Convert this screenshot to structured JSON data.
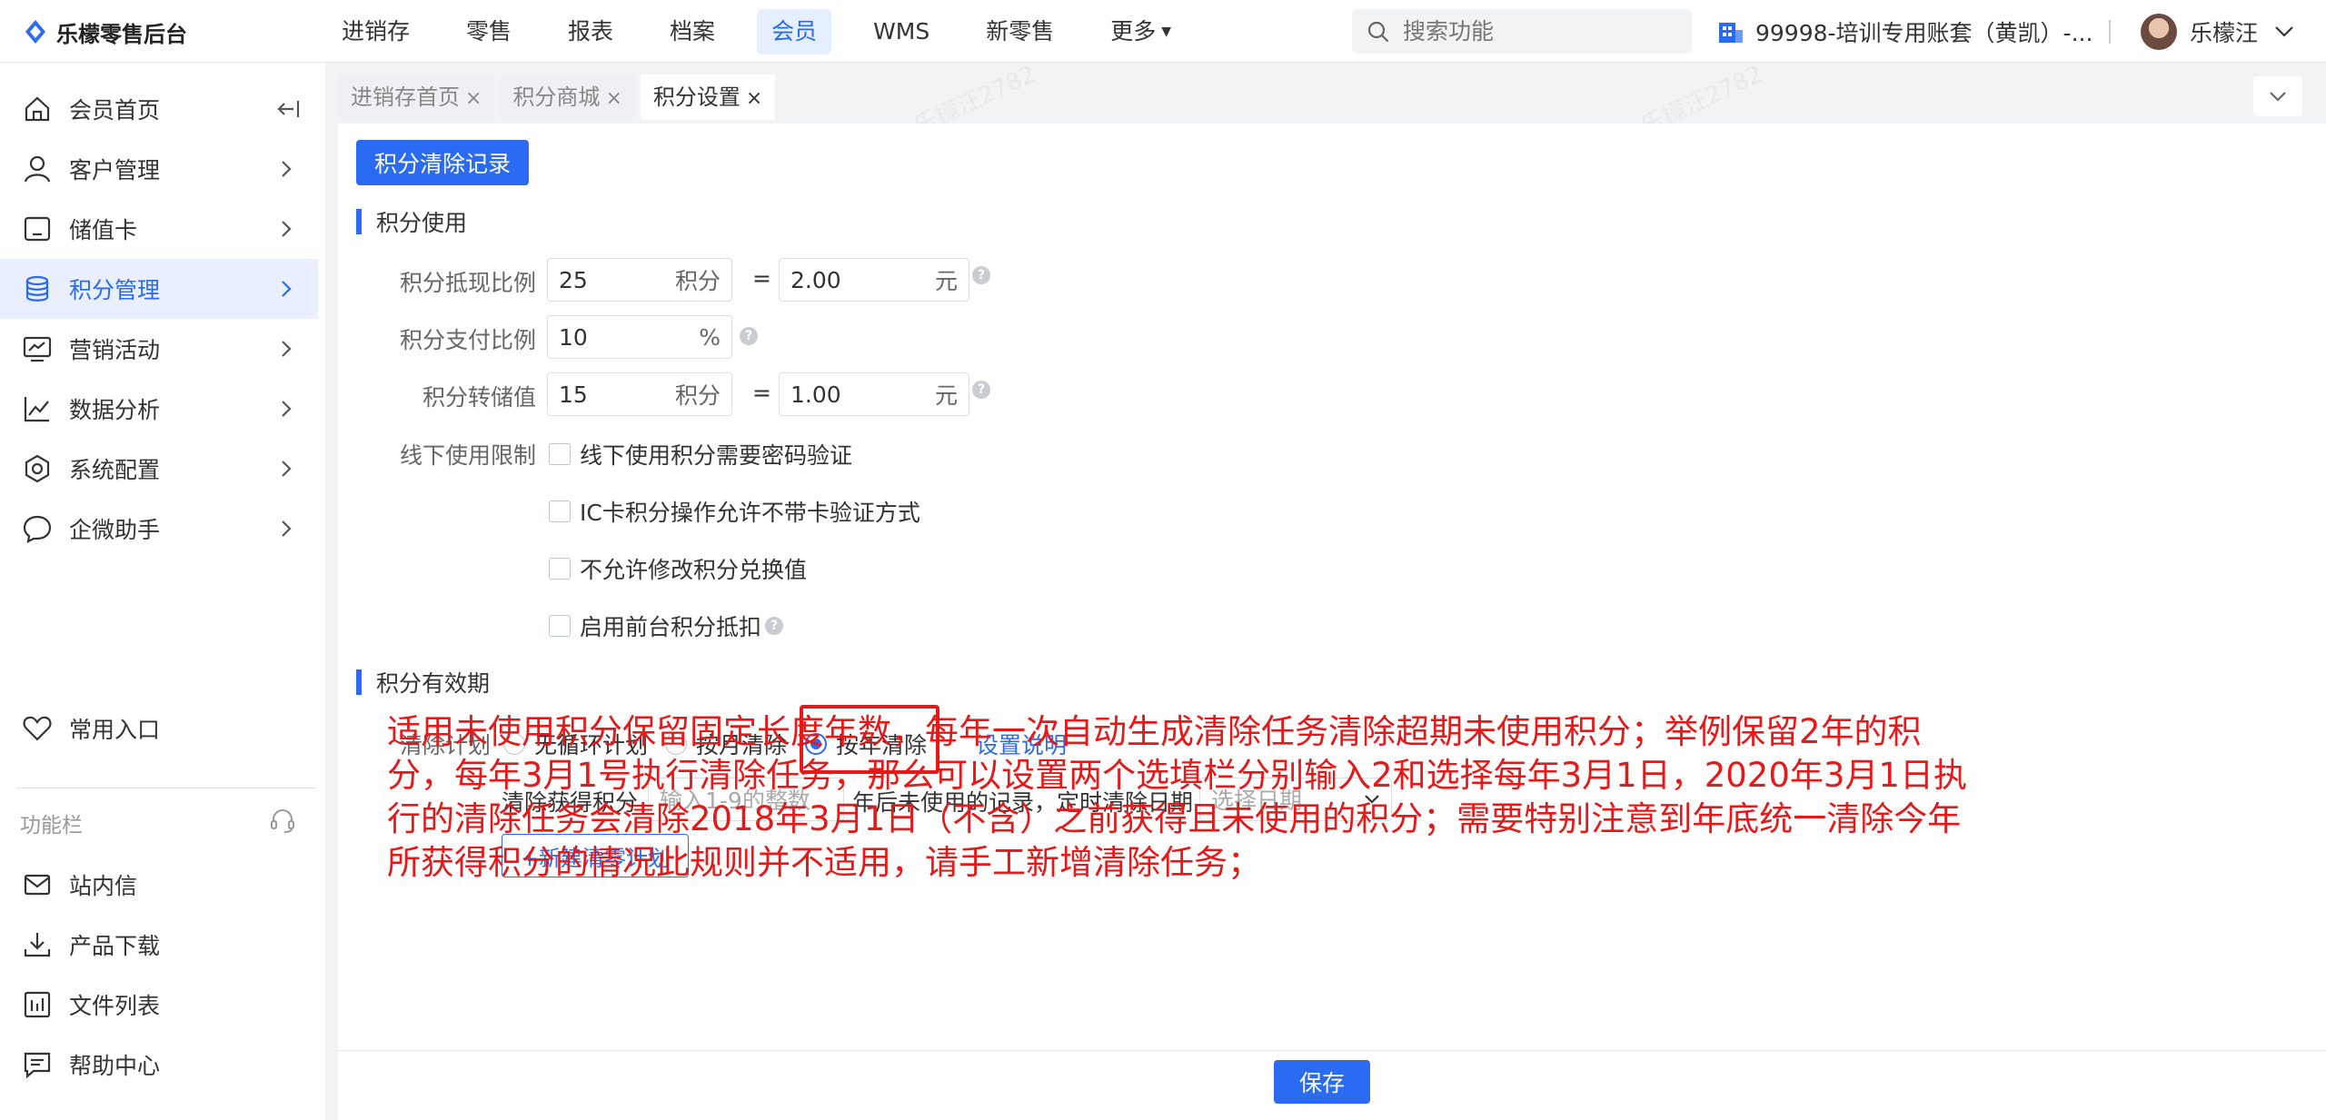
{
  "app": {
    "title": "乐檬零售后台",
    "brand_color": "#2b6af2",
    "annotation_color": "#e81818"
  },
  "topnav": {
    "items": [
      "进销存",
      "零售",
      "报表",
      "档案",
      "会员",
      "WMS",
      "新零售",
      "更多"
    ],
    "active": "会员"
  },
  "search": {
    "placeholder": "搜索功能"
  },
  "account": {
    "label": "99998-培训专用账套（黄凯）-..."
  },
  "user": {
    "name": "乐檬汪"
  },
  "sidebar": {
    "items": [
      {
        "label": "会员首页",
        "icon": "home-icon"
      },
      {
        "label": "客户管理",
        "icon": "user-icon"
      },
      {
        "label": "储值卡",
        "icon": "card-icon"
      },
      {
        "label": "积分管理",
        "icon": "database-icon"
      },
      {
        "label": "营销活动",
        "icon": "marketing-icon"
      },
      {
        "label": "数据分析",
        "icon": "chart-icon"
      },
      {
        "label": "系统配置",
        "icon": "settings-icon"
      },
      {
        "label": "企微助手",
        "icon": "chat-icon"
      }
    ],
    "active": "积分管理",
    "favorite": "常用入口",
    "group_label": "功能栏",
    "bottom_items": [
      "站内信",
      "产品下载",
      "文件列表",
      "帮助中心"
    ]
  },
  "tabs": [
    {
      "label": "进销存首页",
      "close": "×"
    },
    {
      "label": "积分商城",
      "close": "×"
    },
    {
      "label": "积分设置",
      "close": "×"
    }
  ],
  "main": {
    "clear_record_button": "积分清除记录",
    "usage": {
      "title": "积分使用",
      "cash_ratio": {
        "label": "积分抵现比例",
        "points": "25",
        "points_unit": "积分",
        "eq": "=",
        "yuan": "2.00",
        "yuan_unit": "元"
      },
      "pay_ratio": {
        "label": "积分支付比例",
        "value": "10",
        "unit": "%"
      },
      "stored_value": {
        "label": "积分转储值",
        "points": "15",
        "points_unit": "积分",
        "eq": "=",
        "yuan": "1.00",
        "yuan_unit": "元"
      },
      "offline_limit": {
        "label": "线下使用限制",
        "options": [
          "线下使用积分需要密码验证",
          "IC卡积分操作允许不带卡验证方式",
          "不允许修改积分兑换值",
          "启用前台积分抵扣"
        ]
      }
    },
    "validity": {
      "title": "积分有效期",
      "plan_label": "清除计划",
      "radios": [
        "无循环计划",
        "按月清除",
        "按年清除"
      ],
      "selected": "按年清除",
      "explain_link": "设置说明",
      "clear_points_label": "清除获得积分",
      "years_placeholder": "输入1-9的整数",
      "after_text": "年后未使用的记录，定时清除日期",
      "date_placeholder": "选择日期",
      "new_plan_button": "+新建清零计划"
    },
    "annotation": "适用未使用积分保留固定长度年数，每年一次自动生成清除任务清除超期未使用积分；举例保留2年的积分，每年3月1号执行清除任务，那么可以设置两个选填栏分别输入2和选择每年3月1日，2020年3月1日执行的清除任务会清除2018年3月1日（不含）之前获得且未使用的积分；需要特别注意到年底统一清除今年所获得积分的情况此规则并不适用，请手工新增清除任务；"
  },
  "footer": {
    "save_button": "保存"
  },
  "watermark": "乐檬汪2782"
}
